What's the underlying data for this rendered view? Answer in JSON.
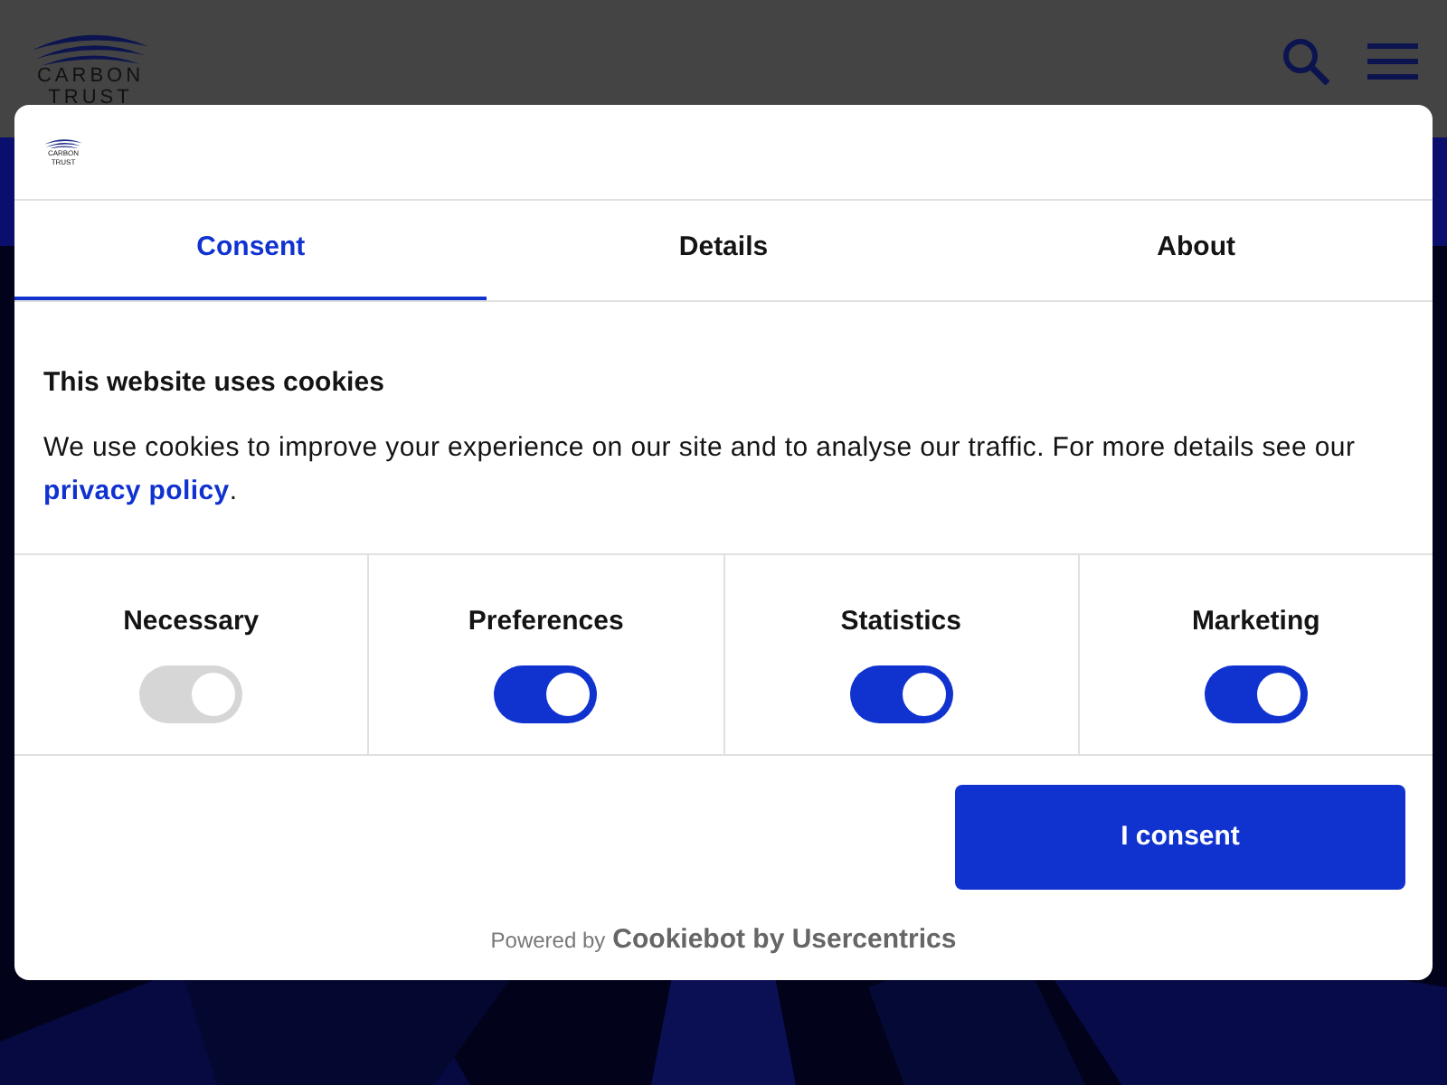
{
  "header": {
    "logo": [
      "CARBON",
      "TRUST"
    ]
  },
  "dialog": {
    "logo": [
      "CARBON",
      "TRUST"
    ],
    "tabs": [
      {
        "label": "Consent",
        "selected": true
      },
      {
        "label": "Details",
        "selected": false
      },
      {
        "label": "About",
        "selected": false
      }
    ],
    "title": "This website uses cookies",
    "text": "We use cookies to improve your experience on our site and to analyse our traffic. For more details see our",
    "link": "privacy policy",
    "text_end": ".",
    "categories": [
      {
        "label": "Necessary",
        "on": true,
        "disabled": true
      },
      {
        "label": "Preferences",
        "on": true,
        "disabled": false
      },
      {
        "label": "Statistics",
        "on": true,
        "disabled": false
      },
      {
        "label": "Marketing",
        "on": true,
        "disabled": false
      }
    ],
    "button": "I consent",
    "footer": {
      "prefix": "Powered by",
      "brand": "Cookiebot by Usercentrics"
    }
  }
}
